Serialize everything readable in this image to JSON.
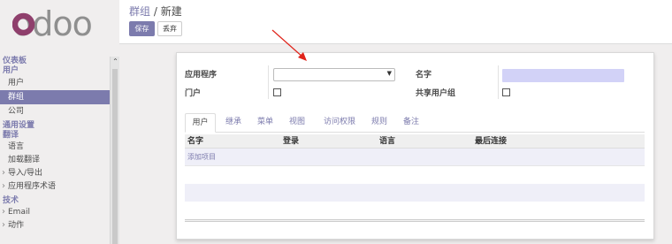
{
  "brand": {
    "logo_text": "odoo"
  },
  "sidebar": {
    "sections": [
      {
        "header": "仪表板",
        "items": []
      },
      {
        "header": "用户",
        "items": [
          {
            "label": "用户",
            "active": false
          },
          {
            "label": "群组",
            "active": true
          },
          {
            "label": "公司",
            "active": false
          }
        ]
      },
      {
        "header": "通用设置",
        "items": []
      },
      {
        "header": "翻译",
        "items": [
          {
            "label": "语言"
          },
          {
            "label": "加载翻译"
          },
          {
            "label": "导入/导出",
            "expand": true
          },
          {
            "label": "应用程序术语",
            "expand": true
          }
        ]
      },
      {
        "header": "技术",
        "items": [
          {
            "label": "Email",
            "expand": true
          },
          {
            "label": "动作",
            "expand": true
          }
        ]
      }
    ]
  },
  "breadcrumb": {
    "parent": "群组",
    "separator": "/",
    "current": "新建"
  },
  "toolbar": {
    "save_label": "保存",
    "discard_label": "丢弃"
  },
  "form": {
    "application_label": "应用程序",
    "application_value": "",
    "portal_label": "门户",
    "portal_checked": false,
    "name_label": "名字",
    "name_value": "",
    "shared_label": "共享用户组",
    "shared_checked": false
  },
  "tabs": [
    {
      "label": "用户",
      "active": true
    },
    {
      "label": "继承"
    },
    {
      "label": "菜单"
    },
    {
      "label": "视图"
    },
    {
      "label": "访问权限"
    },
    {
      "label": "规则"
    },
    {
      "label": "备注"
    }
  ],
  "table": {
    "columns": [
      "名字",
      "登录",
      "语言",
      "最后连接"
    ],
    "add_item_label": "添加项目",
    "rows": []
  },
  "colors": {
    "accent": "#7c7bad",
    "annotation_arrow": "#e0241b",
    "required_field": "#d2d2f7"
  }
}
